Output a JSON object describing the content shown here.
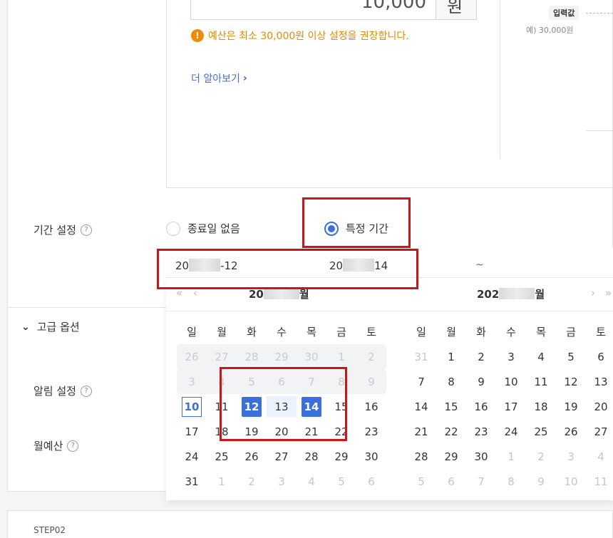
{
  "budget": {
    "amount_value": "10,000",
    "unit": "원",
    "warning": "예산은 최소 30,000원 이상 설정을 권장합니다.",
    "learn_more": "더 알아보기",
    "input_tag": "입력값",
    "example": "예) 30,000원"
  },
  "period": {
    "label": "기간 설정",
    "option_no_end": "종료일 없음",
    "option_specific": "특정 기간",
    "start_prefix": "20",
    "start_suffix": "-12",
    "tilde": "~",
    "end_prefix": "20",
    "end_suffix": "14"
  },
  "advanced": {
    "label": "고급 옵션",
    "alert_label": "알림 설정",
    "monthly_label": "월예산"
  },
  "calendar": {
    "nav_prev_year": "«",
    "nav_prev": "‹",
    "nav_next": "›",
    "nav_next_year": "»",
    "left_title_prefix": "20",
    "left_title_suffix": "월",
    "right_title_prefix": "202",
    "right_title_suffix": "월",
    "weekdays": [
      "일",
      "월",
      "화",
      "수",
      "목",
      "금",
      "토"
    ],
    "left_weeks": [
      [
        "26",
        "27",
        "28",
        "29",
        "30",
        "1",
        "2"
      ],
      [
        "3",
        "4",
        "5",
        "6",
        "7",
        "8",
        "9"
      ],
      [
        "10",
        "11",
        "12",
        "13",
        "14",
        "15",
        "16"
      ],
      [
        "17",
        "18",
        "19",
        "20",
        "21",
        "22",
        "23"
      ],
      [
        "24",
        "25",
        "26",
        "27",
        "28",
        "29",
        "30"
      ],
      [
        "31",
        "1",
        "2",
        "3",
        "4",
        "5",
        "6"
      ]
    ],
    "right_weeks": [
      [
        "31",
        "1",
        "2",
        "3",
        "4",
        "5",
        "6"
      ],
      [
        "7",
        "8",
        "9",
        "10",
        "11",
        "12",
        "13"
      ],
      [
        "14",
        "15",
        "16",
        "17",
        "18",
        "19",
        "20"
      ],
      [
        "21",
        "22",
        "23",
        "24",
        "25",
        "26",
        "27"
      ],
      [
        "28",
        "29",
        "30",
        "1",
        "2",
        "3",
        "4"
      ],
      [
        "5",
        "6",
        "7",
        "8",
        "9",
        "10",
        "11"
      ]
    ],
    "accent": "#3a6fdc"
  },
  "footer": {
    "step": "STEP02"
  }
}
